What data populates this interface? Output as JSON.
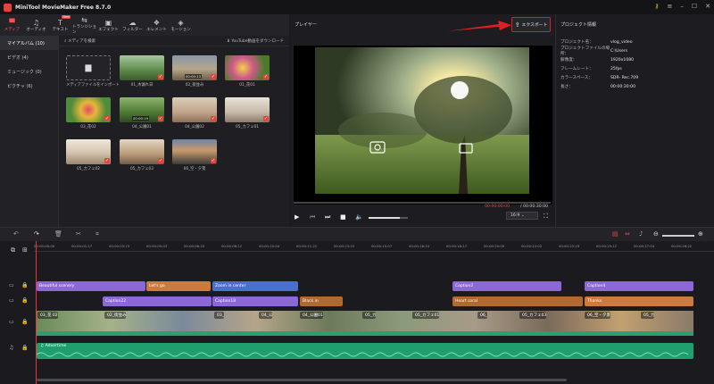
{
  "app": {
    "title": "MiniTool MovieMaker Free 8.7.0"
  },
  "toolbar": {
    "tabs": [
      {
        "label": "メディア",
        "icon": "folder-icon"
      },
      {
        "label": "オーディオ",
        "icon": "music-icon"
      },
      {
        "label": "テキスト",
        "icon": "text-icon",
        "badge": "New"
      },
      {
        "label": "トランジション",
        "icon": "transition-icon"
      },
      {
        "label": "エフェクト",
        "icon": "effect-icon"
      },
      {
        "label": "フィルター",
        "icon": "filter-icon"
      },
      {
        "label": "エレメント",
        "icon": "element-icon"
      },
      {
        "label": "モーション",
        "icon": "motion-icon"
      }
    ]
  },
  "leftnav": {
    "items": [
      "マイアルバム (10)",
      "ビデオ (4)",
      "ミュージック (0)",
      "ピクチャ (6)"
    ]
  },
  "media": {
    "search_label": "メディアを検索",
    "download_label": "YouTube動画をダウンロード",
    "import_label": "メディアファイルをインポート",
    "clips": [
      {
        "label": "01_木漏れ日",
        "duration": ""
      },
      {
        "label": "02_街並み",
        "duration": "00:00:13"
      },
      {
        "label": "01_花01",
        "duration": ""
      },
      {
        "label": "03_花02",
        "duration": ""
      },
      {
        "label": "04_公園01",
        "duration": "00:00:19"
      },
      {
        "label": "04_公園02",
        "duration": ""
      },
      {
        "label": "05_カフェ01",
        "duration": ""
      },
      {
        "label": "05_カフェ02",
        "duration": ""
      },
      {
        "label": "05_カフェ03",
        "duration": ""
      },
      {
        "label": "06_空・夕景",
        "duration": ""
      }
    ]
  },
  "player": {
    "title": "プレイヤー",
    "export_label": "エクスポート",
    "time_current": "00:00:00:00",
    "time_total": "00:00:30:00",
    "ratio": "16:9",
    "volume": 0.8
  },
  "info": {
    "title": "プロジェクト情報",
    "rows": [
      {
        "k": "プロジェクト名：",
        "v": "vlog_video"
      },
      {
        "k": "プロジェクトファイルの場所：",
        "v": "C:\\Users"
      },
      {
        "k": "解像度：",
        "v": "1920x1080"
      },
      {
        "k": "フレームレート：",
        "v": "25fps"
      },
      {
        "k": "カラースペース：",
        "v": "SDR- Rec.709"
      },
      {
        "k": "長さ：",
        "v": "00:00:30:00"
      }
    ]
  },
  "timeline": {
    "ruler": [
      "00:00:00:00",
      "00:00:01:17",
      "00:00:03:15",
      "00:00:05:03",
      "00:00:06:20",
      "00:00:08:12",
      "00:00:10:04",
      "00:00:11:22",
      "00:00:13:15",
      "00:00:15:07",
      "00:00:16:24",
      "00:00:18:17",
      "00:00:20:09",
      "00:00:22:02",
      "00:00:23:19",
      "00:00:25:12",
      "00:00:27:04",
      "00:00:28:22"
    ],
    "text_track1": [
      "Beautiful scenery",
      "Let's go",
      "Zoom in center",
      "Caption2",
      "Caption4"
    ],
    "text_track2": [
      "Caption22",
      "Caption18",
      "Black in",
      "Heart coral",
      "Thanks"
    ],
    "video_clips": [
      "03_花 02",
      "02_街並み",
      "03_",
      "04_公",
      "04_公園01",
      "05_カ",
      "05_カフェ01",
      "06_",
      "05_カフェ03",
      "06_空・夕景",
      "05_力"
    ],
    "audio_label": "Advertime"
  }
}
